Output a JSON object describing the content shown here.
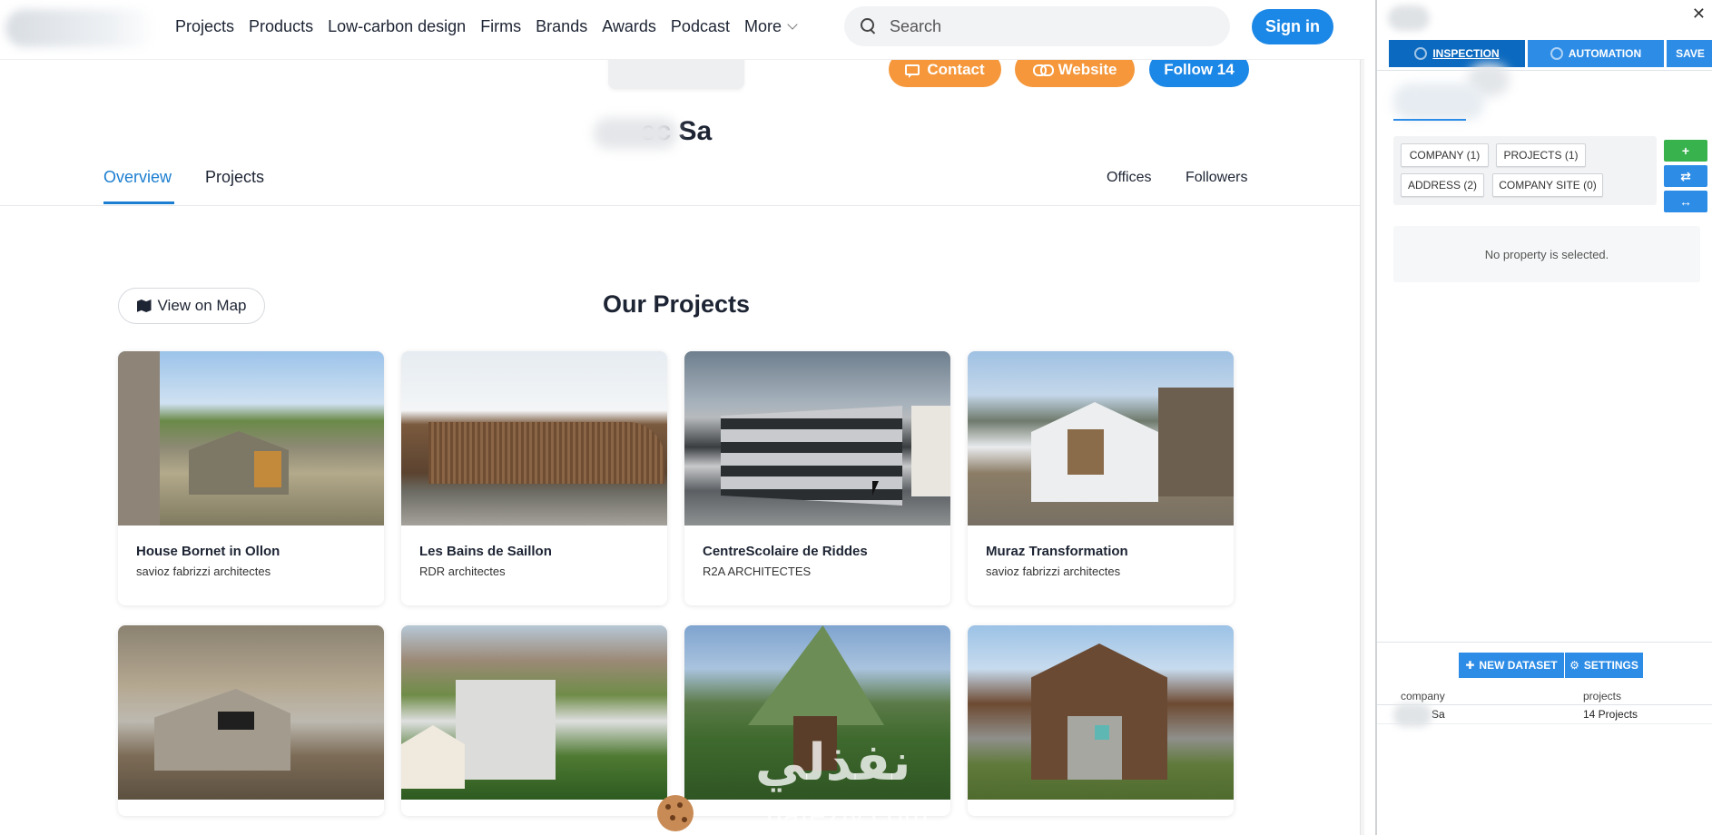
{
  "nav": {
    "links": [
      "Projects",
      "Products",
      "Low-carbon design",
      "Firms",
      "Brands",
      "Awards",
      "Podcast"
    ],
    "more": "More",
    "search_placeholder": "Search",
    "signin": "Sign in"
  },
  "company": {
    "name": "ec Sa",
    "contact": "Contact",
    "website": "Website",
    "follow": "Follow 14"
  },
  "tabs": {
    "overview": "Overview",
    "projects": "Projects",
    "offices": "Offices",
    "followers": "Followers"
  },
  "section": {
    "view_on_map": "View on Map",
    "title": "Our Projects"
  },
  "projects": [
    {
      "title": "House Bornet in Ollon",
      "firm": "savioz fabrizzi architectes"
    },
    {
      "title": "Les Bains de Saillon",
      "firm": "RDR architectes"
    },
    {
      "title": "CentreScolaire de Riddes",
      "firm": "R2A ARCHITECTES"
    },
    {
      "title": "Muraz Transformation",
      "firm": "savioz fabrizzi architectes"
    }
  ],
  "watermark": {
    "arabic": "نفذلي",
    "latin": "nafezly.com"
  },
  "panel": {
    "tabs": {
      "inspection": "INSPECTION",
      "automation": "AUTOMATION",
      "save": "SAVE"
    },
    "chips": {
      "company": "COMPANY (1)",
      "projects": "PROJECTS (1)",
      "address": "ADDRESS (2)",
      "company_site": "COMPANY SITE (0)"
    },
    "side_buttons": {
      "add": "+",
      "refresh": "⇄",
      "resize": "↔"
    },
    "empty": "No property is selected.",
    "actions": {
      "new_dataset": "NEW DATASET",
      "settings": "SETTINGS"
    },
    "table": {
      "headers": [
        "company",
        "projects"
      ],
      "rows": [
        [
          "Sa",
          "14 Projects"
        ]
      ]
    }
  },
  "colors": {
    "brand_blue": "#1b87e6",
    "orange": "#f5973a",
    "panel_blue": "#2d8ce6",
    "green": "#37b24d"
  }
}
